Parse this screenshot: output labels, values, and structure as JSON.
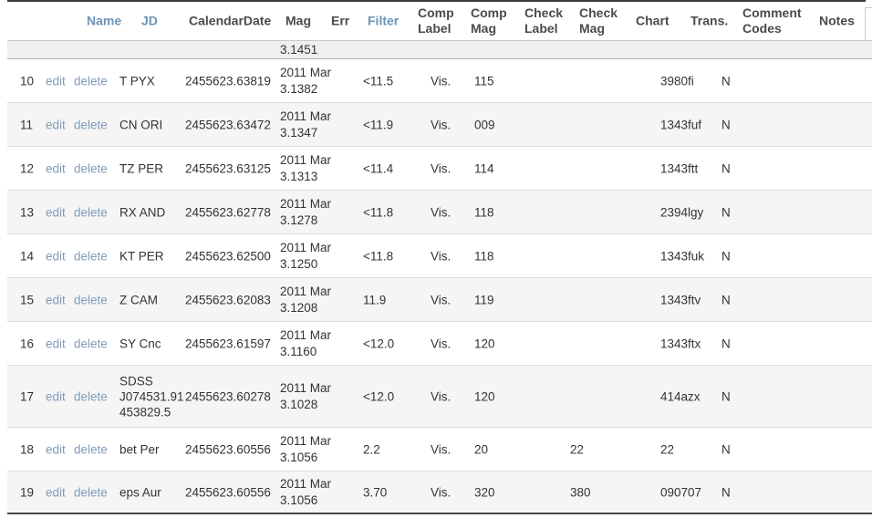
{
  "table": {
    "columns": {
      "name": "Name",
      "jd": "JD",
      "calendar_date": "CalendarDate",
      "mag": "Mag",
      "err": "Err",
      "filter": "Filter",
      "comp_label": "Comp Label",
      "comp_mag": "Comp Mag",
      "check_label": "Check Label",
      "check_mag": "Check Mag",
      "chart": "Chart",
      "trans": "Trans.",
      "comment_codes": "Comment Codes",
      "notes": "Notes"
    },
    "actions": {
      "edit": "edit",
      "delete": "delete"
    },
    "partial_row": {
      "calendar_fragment": "3.1451"
    },
    "rows": [
      {
        "num": "10",
        "name": "T PYX",
        "jd": "2455623.63819",
        "cal1": "2011 Mar",
        "cal2": "3.1382",
        "mag": "<11.5",
        "filter": "Vis.",
        "comp_mag": "115",
        "check_mag": "",
        "chart": "3980fi",
        "trans": "N"
      },
      {
        "num": "11",
        "name": "CN ORI",
        "jd": "2455623.63472",
        "cal1": "2011 Mar",
        "cal2": "3.1347",
        "mag": "<11.9",
        "filter": "Vis.",
        "comp_mag": "009",
        "check_mag": "",
        "chart": "1343fuf",
        "trans": "N"
      },
      {
        "num": "12",
        "name": "TZ PER",
        "jd": "2455623.63125",
        "cal1": "2011 Mar",
        "cal2": "3.1313",
        "mag": "<11.4",
        "filter": "Vis.",
        "comp_mag": "114",
        "check_mag": "",
        "chart": "1343ftt",
        "trans": "N"
      },
      {
        "num": "13",
        "name": "RX AND",
        "jd": "2455623.62778",
        "cal1": "2011 Mar",
        "cal2": "3.1278",
        "mag": "<11.8",
        "filter": "Vis.",
        "comp_mag": "118",
        "check_mag": "",
        "chart": "2394lgy",
        "trans": "N"
      },
      {
        "num": "14",
        "name": "KT PER",
        "jd": "2455623.62500",
        "cal1": "2011 Mar",
        "cal2": "3.1250",
        "mag": "<11.8",
        "filter": "Vis.",
        "comp_mag": "118",
        "check_mag": "",
        "chart": "1343fuk",
        "trans": "N"
      },
      {
        "num": "15",
        "name": "Z CAM",
        "jd": "2455623.62083",
        "cal1": "2011 Mar",
        "cal2": "3.1208",
        "mag": "11.9",
        "filter": "Vis.",
        "comp_mag": "119",
        "check_mag": "",
        "chart": "1343ftv",
        "trans": "N"
      },
      {
        "num": "16",
        "name": "SY Cnc",
        "jd": "2455623.61597",
        "cal1": "2011 Mar",
        "cal2": "3.1160",
        "mag": "<12.0",
        "filter": "Vis.",
        "comp_mag": "120",
        "check_mag": "",
        "chart": "1343ftx",
        "trans": "N"
      },
      {
        "num": "17",
        "name": "SDSS J074531.91 453829.5",
        "jd": "2455623.60278",
        "cal1": "2011 Mar",
        "cal2": "3.1028",
        "mag": "<12.0",
        "filter": "Vis.",
        "comp_mag": "120",
        "check_mag": "",
        "chart": "414azx",
        "trans": "N"
      },
      {
        "num": "18",
        "name": "bet Per",
        "jd": "2455623.60556",
        "cal1": "2011 Mar",
        "cal2": "3.1056",
        "mag": "2.2",
        "filter": "Vis.",
        "comp_mag": "20",
        "check_mag": "22",
        "chart": "22",
        "trans": "N"
      },
      {
        "num": "19",
        "name": "eps Aur",
        "jd": "2455623.60556",
        "cal1": "2011 Mar",
        "cal2": "3.1056",
        "mag": "3.70",
        "filter": "Vis.",
        "comp_mag": "320",
        "check_mag": "380",
        "chart": "090707",
        "trans": "N"
      }
    ]
  },
  "colors": {
    "link_header": "#6d93b6",
    "link_row": "#7f9cba",
    "stripe": "#f5f5f5",
    "row_border": "#dcdcdc",
    "dark_border": "#4a4a4a"
  }
}
